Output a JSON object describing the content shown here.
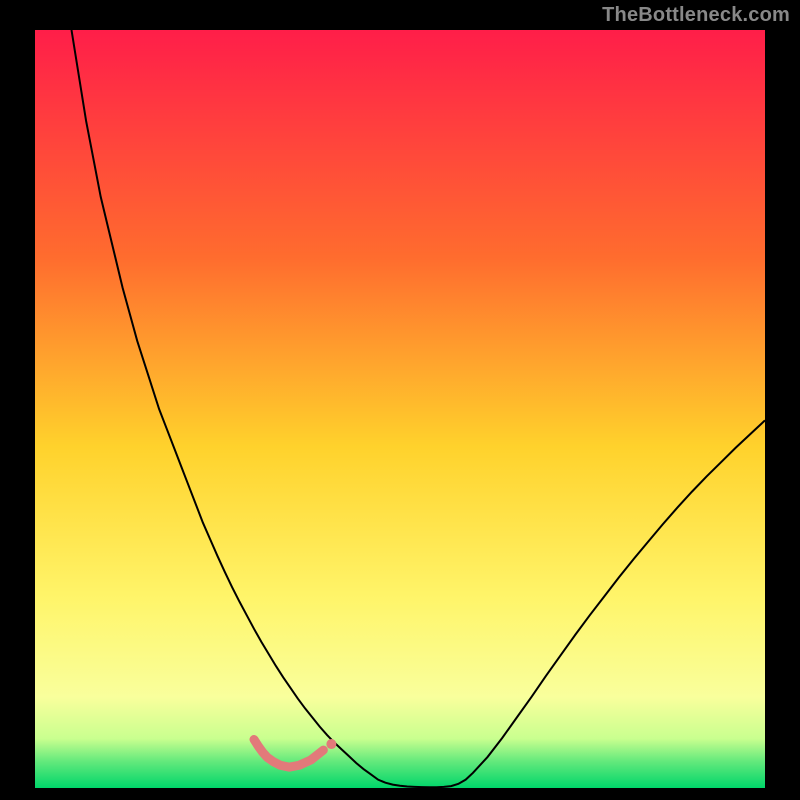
{
  "watermark": "TheBottleneck.com",
  "chart_data": {
    "type": "line",
    "title": "",
    "xlabel": "",
    "ylabel": "",
    "xlim": [
      0,
      100
    ],
    "ylim": [
      0,
      100
    ],
    "grid": false,
    "legend": false,
    "background_gradient": {
      "stops": [
        {
          "offset": 0.0,
          "color": "#FF1E49"
        },
        {
          "offset": 0.3,
          "color": "#FF6C2E"
        },
        {
          "offset": 0.55,
          "color": "#FFD22C"
        },
        {
          "offset": 0.75,
          "color": "#FFF56A"
        },
        {
          "offset": 0.88,
          "color": "#F9FF9C"
        },
        {
          "offset": 0.935,
          "color": "#C9FF8F"
        },
        {
          "offset": 0.965,
          "color": "#63E97C"
        },
        {
          "offset": 1.0,
          "color": "#00D66A"
        }
      ]
    },
    "series": [
      {
        "name": "bottleneck-curve",
        "color": "#000000",
        "width": 2.0,
        "x": [
          5,
          6,
          7,
          8,
          9,
          10,
          11,
          12,
          13,
          14,
          15,
          16,
          17,
          18,
          19,
          20,
          21,
          22,
          23,
          24,
          25,
          26,
          27,
          28,
          29,
          30,
          31,
          32,
          33,
          34,
          35,
          36,
          37,
          38,
          39,
          40,
          41,
          42,
          43,
          44,
          45,
          46,
          47,
          48,
          49,
          50,
          51,
          52,
          53,
          54,
          55,
          56,
          57,
          58,
          59,
          60,
          62,
          64,
          66,
          68,
          70,
          72,
          74,
          76,
          78,
          80,
          82,
          84,
          86,
          88,
          90,
          92,
          94,
          96,
          98,
          100
        ],
        "y": [
          100,
          94,
          88,
          83,
          78,
          74,
          70,
          66,
          62.5,
          59,
          56,
          53,
          50,
          47.5,
          45,
          42.5,
          40,
          37.5,
          35,
          32.8,
          30.6,
          28.5,
          26.5,
          24.6,
          22.8,
          21,
          19.3,
          17.7,
          16.1,
          14.6,
          13.2,
          11.8,
          10.5,
          9.3,
          8.1,
          7.0,
          6.0,
          5.1,
          4.2,
          3.3,
          2.5,
          1.8,
          1.1,
          0.7,
          0.45,
          0.3,
          0.2,
          0.15,
          0.12,
          0.1,
          0.1,
          0.15,
          0.25,
          0.55,
          1.1,
          2.0,
          4.1,
          6.6,
          9.3,
          12.0,
          14.8,
          17.5,
          20.2,
          22.8,
          25.3,
          27.8,
          30.2,
          32.5,
          34.8,
          37.0,
          39.1,
          41.1,
          43.0,
          44.9,
          46.7,
          48.5
        ]
      }
    ],
    "highlight_segment": {
      "color": "#E27A7A",
      "width": 9,
      "linecap": "round",
      "points_x": [
        30.0,
        30.6,
        31.2,
        31.8,
        32.6,
        33.6,
        34.8,
        36.2,
        37.8,
        39.5
      ],
      "points_y": [
        3.9,
        3.0,
        2.2,
        1.55,
        1.0,
        0.5,
        0.25,
        0.5,
        1.2,
        2.5
      ],
      "end_marker": {
        "x": 40.6,
        "y": 3.3,
        "r": 5
      }
    }
  }
}
